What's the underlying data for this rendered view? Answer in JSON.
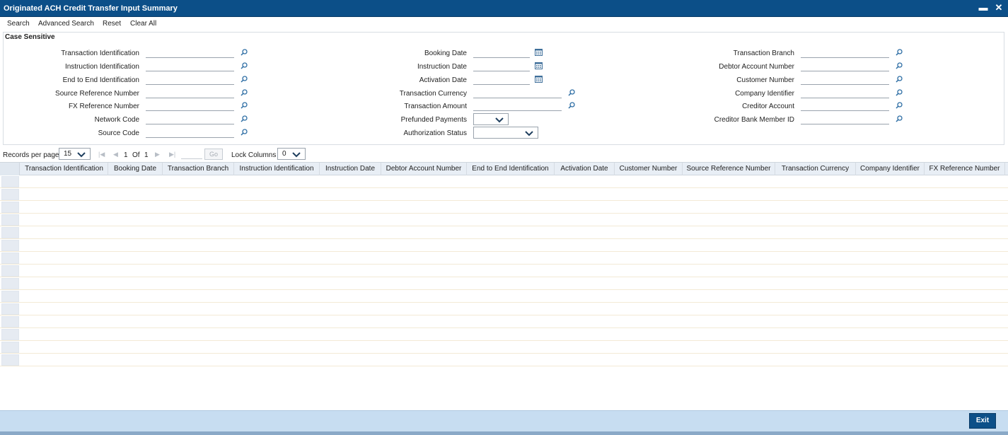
{
  "window": {
    "title": "Originated ACH Credit Transfer Input Summary",
    "minimize_label": "▬",
    "close_label": "✕"
  },
  "toolbar": {
    "search": "Search",
    "advanced_search": "Advanced Search",
    "reset": "Reset",
    "clear_all": "Clear All"
  },
  "criteria": {
    "legend": "Case Sensitive",
    "col1": [
      "Transaction Identification",
      "Instruction Identification",
      "End to End Identification",
      "Source Reference Number",
      "FX Reference Number",
      "Network Code",
      "Source Code"
    ],
    "col2": {
      "booking_date": "Booking Date",
      "instruction_date": "Instruction Date",
      "activation_date": "Activation Date",
      "transaction_currency": "Transaction Currency",
      "transaction_amount": "Transaction Amount",
      "prefunded_payments": "Prefunded Payments",
      "authorization_status": "Authorization Status"
    },
    "col3": [
      "Transaction Branch",
      "Debtor Account Number",
      "Customer Number",
      "Company Identifier",
      "Creditor Account",
      "Creditor Bank Member ID"
    ],
    "prefunded_value": "",
    "authorization_value": ""
  },
  "pager": {
    "records_label": "Records per page",
    "records_value": "15",
    "current_page": "1",
    "of_label": "Of",
    "total_pages": "1",
    "go_label": "Go",
    "lock_label": "Lock Columns",
    "lock_value": "0"
  },
  "grid": {
    "columns": [
      "Transaction Identification",
      "Booking Date",
      "Transaction Branch",
      "Instruction Identification",
      "Instruction Date",
      "Debtor Account Number",
      "End to End Identification",
      "Activation Date",
      "Customer Number",
      "Source Reference Number",
      "Transaction Currency",
      "Company Identifier",
      "FX Reference Number"
    ],
    "row_count": 15
  },
  "footer": {
    "exit_label": "Exit"
  },
  "icons": {
    "lens": "search-lens-icon",
    "calendar": "calendar-icon",
    "chevron": "chevron-down-icon"
  },
  "colors": {
    "titlebar": "#0c4f88",
    "footer": "#c7ddf1",
    "lens": "#2f6fa5"
  }
}
